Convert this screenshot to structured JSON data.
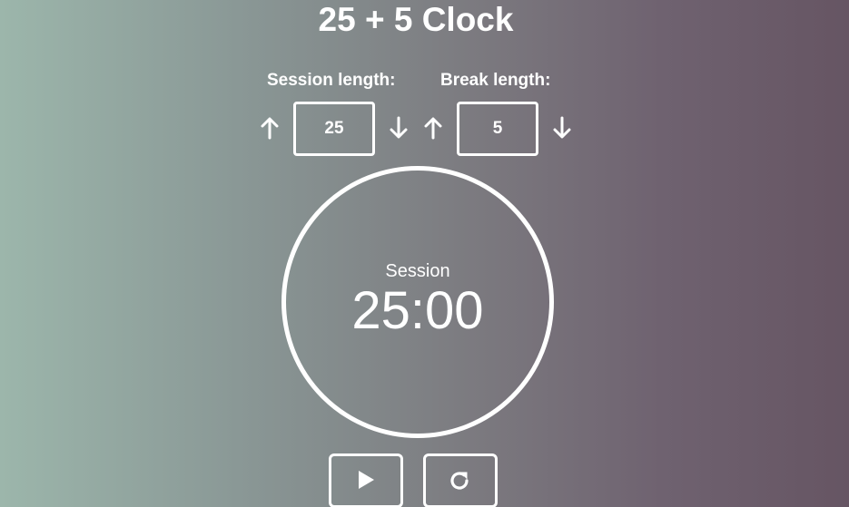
{
  "app": {
    "title": "25 + 5 Clock"
  },
  "session": {
    "label": "Session length:",
    "value": "25",
    "increment_icon": "arrow-up-icon",
    "decrement_icon": "arrow-down-icon"
  },
  "break": {
    "label": "Break length:",
    "value": "5",
    "increment_icon": "arrow-up-icon",
    "decrement_icon": "arrow-down-icon"
  },
  "timer": {
    "label": "Session",
    "time": "25:00"
  },
  "controls": {
    "start_icon": "play-icon",
    "reset_icon": "refresh-icon"
  },
  "colors": {
    "foreground": "#ffffff",
    "gradient_left": "#9cb6ab",
    "gradient_right": "#665563"
  }
}
